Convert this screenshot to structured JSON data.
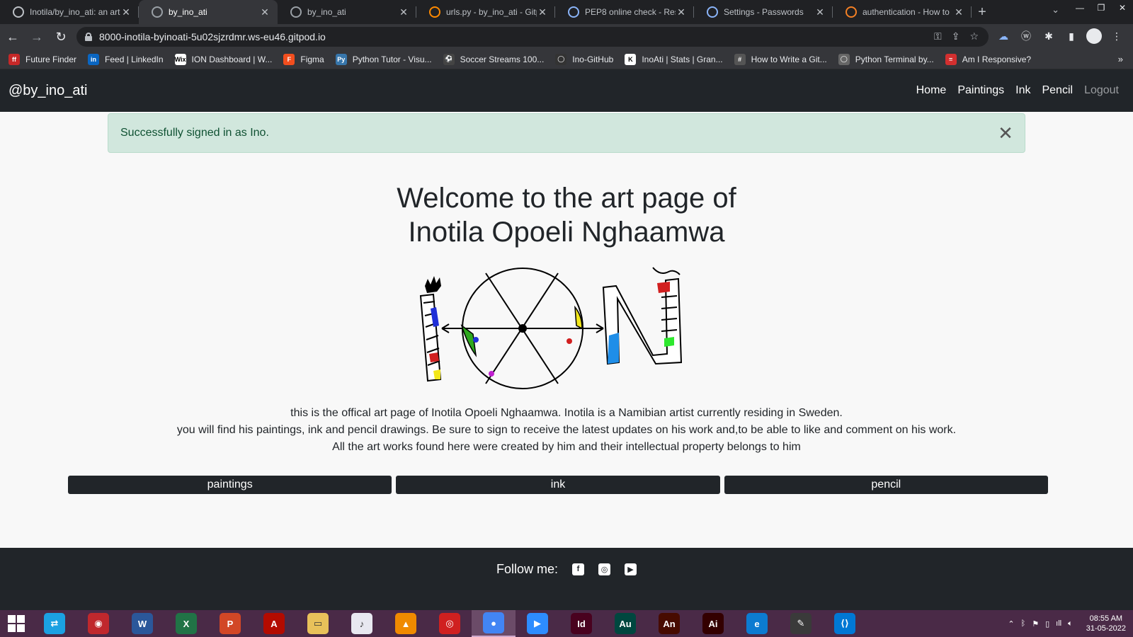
{
  "browser": {
    "tabs": [
      {
        "title": "Inotila/by_ino_ati: an art",
        "active": false,
        "favicon": "github-icon"
      },
      {
        "title": "by_ino_ati",
        "active": true,
        "favicon": "globe-icon"
      },
      {
        "title": "by_ino_ati",
        "active": false,
        "favicon": "globe-icon"
      },
      {
        "title": "urls.py - by_ino_ati - Gitp",
        "active": false,
        "favicon": "gitpod-icon"
      },
      {
        "title": "PEP8 online check - Resu",
        "active": false,
        "favicon": "pep8-icon"
      },
      {
        "title": "Settings - Passwords",
        "active": false,
        "favicon": "gear-icon"
      },
      {
        "title": "authentication - How to",
        "active": false,
        "favicon": "stackoverflow-icon"
      }
    ],
    "url": "8000-inotila-byinoati-5u02sjzrdmr.ws-eu46.gitpod.io",
    "bookmarks": [
      {
        "label": "Future Finder",
        "color": "#c62828",
        "glyph": "ff"
      },
      {
        "label": "Feed | LinkedIn",
        "color": "#0a66c2",
        "glyph": "in"
      },
      {
        "label": "ION Dashboard | W...",
        "color": "#ffffff",
        "glyph": "Wix"
      },
      {
        "label": "Figma",
        "color": "#f24e1e",
        "glyph": "F"
      },
      {
        "label": "Python Tutor - Visu...",
        "color": "#3776ab",
        "glyph": "Py"
      },
      {
        "label": "Soccer Streams 100...",
        "color": "#444444",
        "glyph": "⚽"
      },
      {
        "label": "Ino-GitHub",
        "color": "#333333",
        "glyph": "◯"
      },
      {
        "label": "InoAti | Stats | Gran...",
        "color": "#ffffff",
        "glyph": "K"
      },
      {
        "label": "How to Write a Git...",
        "color": "#555555",
        "glyph": "#"
      },
      {
        "label": "Python Terminal by...",
        "color": "#666666",
        "glyph": "◯"
      },
      {
        "label": "Am I Responsive?",
        "color": "#d32f2f",
        "glyph": "="
      }
    ]
  },
  "site": {
    "brand": "@by_ino_ati",
    "nav": [
      {
        "label": "Home",
        "muted": false
      },
      {
        "label": "Paintings",
        "muted": false
      },
      {
        "label": "Ink",
        "muted": false
      },
      {
        "label": "Pencil",
        "muted": false
      },
      {
        "label": "Logout",
        "muted": true
      }
    ],
    "alert": "Successfully signed in as Ino.",
    "hero_line1": "Welcome to the art page of",
    "hero_line2": "Inotila Opoeli Nghaamwa",
    "intro": [
      "this is the offical art page of Inotila Opoeli Nghaamwa. Inotila is a Namibian artist currently residing in Sweden.",
      "you will find his paintings, ink and pencil drawings. Be sure to sign to receive the latest updates on his work and,to be able to like and comment on his work.",
      "All the art works found here were created by him and their intellectual property belongs to him"
    ],
    "buttons": [
      "paintings",
      "ink",
      "pencil"
    ],
    "footer_label": "Follow me:",
    "socials": [
      "facebook-icon",
      "instagram-icon",
      "youtube-icon"
    ]
  },
  "taskbar": {
    "apps": [
      {
        "name": "teamviewer-icon",
        "color": "#1ba1e2",
        "glyph": "⇄"
      },
      {
        "name": "red-app-icon",
        "color": "#c0282d",
        "glyph": "◉"
      },
      {
        "name": "word-icon",
        "color": "#2b579a",
        "glyph": "W"
      },
      {
        "name": "excel-icon",
        "color": "#217346",
        "glyph": "X"
      },
      {
        "name": "powerpoint-icon",
        "color": "#d24726",
        "glyph": "P"
      },
      {
        "name": "acrobat-icon",
        "color": "#b30b00",
        "glyph": "A"
      },
      {
        "name": "file-explorer-icon",
        "color": "#e8c15a",
        "glyph": "▭"
      },
      {
        "name": "itunes-icon",
        "color": "#e8e8f0",
        "glyph": "♪"
      },
      {
        "name": "vlc-icon",
        "color": "#f08a00",
        "glyph": "▲"
      },
      {
        "name": "media-app-icon",
        "color": "#d02020",
        "glyph": "◎"
      },
      {
        "name": "chrome-icon",
        "color": "#4285f4",
        "glyph": "●"
      },
      {
        "name": "zoom-icon",
        "color": "#2d8cff",
        "glyph": "▶"
      },
      {
        "name": "indesign-icon",
        "color": "#49021f",
        "glyph": "Id"
      },
      {
        "name": "audition-icon",
        "color": "#00473f",
        "glyph": "Au"
      },
      {
        "name": "animate-icon",
        "color": "#470b00",
        "glyph": "An"
      },
      {
        "name": "illustrator-icon",
        "color": "#330000",
        "glyph": "Ai"
      },
      {
        "name": "edge-icon",
        "color": "#0c7bd1",
        "glyph": "e"
      },
      {
        "name": "pen-app-icon",
        "color": "#3a3a3a",
        "glyph": "✎"
      },
      {
        "name": "vscode-icon",
        "color": "#0078d4",
        "glyph": "⟨⟩"
      }
    ],
    "time": "08:55 AM",
    "date": "31-05-2022"
  }
}
